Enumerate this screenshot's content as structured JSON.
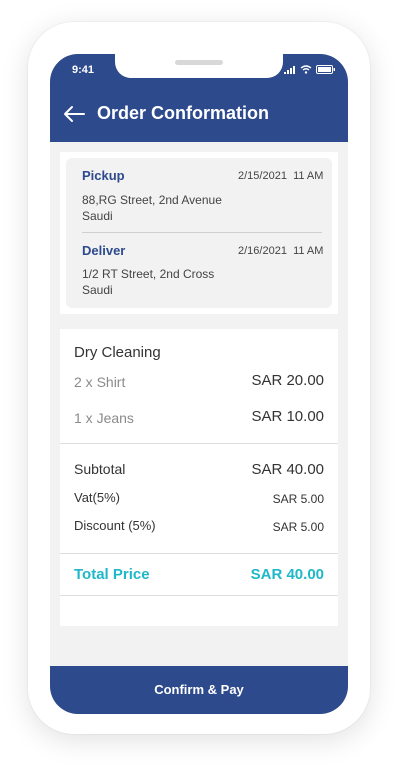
{
  "status_bar": {
    "time": "9:41"
  },
  "header": {
    "title": "Order Conformation"
  },
  "pickup": {
    "label": "Pickup",
    "date": "2/15/2021",
    "time": "11 AM",
    "address_line1": "88,RG Street, 2nd Avenue",
    "address_line2": "Saudi"
  },
  "deliver": {
    "label": "Deliver",
    "date": "2/16/2021",
    "time": "11 AM",
    "address_line1": "1/2 RT Street, 2nd Cross",
    "address_line2": "Saudi"
  },
  "order": {
    "category": "Dry Cleaning",
    "items": [
      {
        "name": "2 x Shirt",
        "price": "SAR 20.00"
      },
      {
        "name": "1 x Jeans",
        "price": "SAR 10.00"
      }
    ],
    "subtotal_label": "Subtotal",
    "subtotal_value": "SAR 40.00",
    "vat_label": "Vat(5%)",
    "vat_value": "SAR 5.00",
    "discount_label": "Discount (5%)",
    "discount_value": "SAR 5.00",
    "total_label": "Total Price",
    "total_value": "SAR 40.00"
  },
  "footer": {
    "confirm_label": "Confirm & Pay"
  },
  "colors": {
    "primary": "#2d4a8d",
    "accent": "#1fb8c8"
  }
}
